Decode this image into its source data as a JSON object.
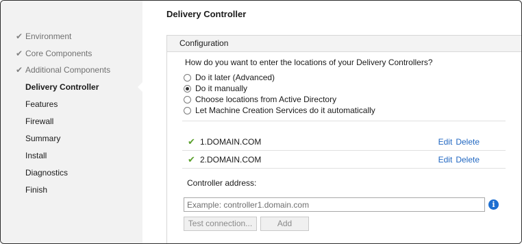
{
  "page": {
    "title": "Delivery Controller"
  },
  "sidebar": {
    "check_glyph": "✔",
    "items": [
      {
        "label": "Environment",
        "state": "done"
      },
      {
        "label": "Core Components",
        "state": "done"
      },
      {
        "label": "Additional Components",
        "state": "done"
      },
      {
        "label": "Delivery Controller",
        "state": "current"
      },
      {
        "label": "Features",
        "state": "pending"
      },
      {
        "label": "Firewall",
        "state": "pending"
      },
      {
        "label": "Summary",
        "state": "pending"
      },
      {
        "label": "Install",
        "state": "pending"
      },
      {
        "label": "Diagnostics",
        "state": "pending"
      },
      {
        "label": "Finish",
        "state": "pending"
      }
    ]
  },
  "panel": {
    "header": "Configuration",
    "question": "How do you want to enter the locations of your Delivery Controllers?",
    "options": [
      {
        "label": "Do it later (Advanced)",
        "selected": false
      },
      {
        "label": "Do it manually",
        "selected": true
      },
      {
        "label": "Choose locations from Active Directory",
        "selected": false
      },
      {
        "label": "Let Machine Creation Services do it automatically",
        "selected": false
      }
    ],
    "controllers": [
      {
        "name": "1.DOMAIN.COM",
        "edit": "Edit",
        "delete": "Delete"
      },
      {
        "name": "2.DOMAIN.COM",
        "edit": "Edit",
        "delete": "Delete"
      }
    ],
    "check_glyph": "✔",
    "address_label": "Controller address:",
    "address_input": {
      "value": "",
      "placeholder": "Example: controller1.domain.com"
    },
    "info_glyph": "i",
    "test_button": "Test connection...",
    "add_button": "Add"
  },
  "colors": {
    "accent_link": "#1f66c1",
    "check_green": "#5aa02c",
    "info_blue": "#1c6ed1"
  }
}
